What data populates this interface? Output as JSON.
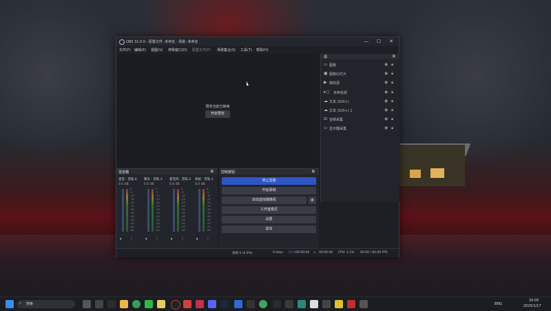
{
  "window": {
    "title": "OBS 31.0.0 - 配置文件: 未命名 - 场景: 未命名",
    "min": "—",
    "max": "☐",
    "close": "✕"
  },
  "menu": [
    "文件(F)",
    "编辑(E)",
    "视图(V)",
    "停靠窗口(D)",
    "配置文件(P)",
    "场景集合(S)",
    "工具(T)",
    "帮助(H)"
  ],
  "preview": {
    "message": "预览当前已禁用",
    "button": "开启预览"
  },
  "sources": {
    "header": "源",
    "items": [
      {
        "label": "图像",
        "icon": "image-icon",
        "glyph": "▭"
      },
      {
        "label": "图像幻灯片",
        "icon": "slideshow-icon",
        "glyph": "▣"
      },
      {
        "label": "媒体源",
        "icon": "play-icon",
        "glyph": "▶"
      },
      {
        "label": "未命名组",
        "icon": "folder-icon",
        "glyph": "▸▢"
      },
      {
        "label": "文本 (GDI+)",
        "icon": "text-icon",
        "glyph": "☁"
      },
      {
        "label": "文本 (GDI+) 2",
        "icon": "text-icon",
        "glyph": "☁"
      },
      {
        "label": "音频采集",
        "icon": "gamepad-icon",
        "glyph": "⊟"
      },
      {
        "label": "显示器采集",
        "icon": "monitor-icon",
        "glyph": "▭"
      }
    ]
  },
  "mixer": {
    "header": "混音器",
    "channels": [
      {
        "name": "混音 - 音轨.6",
        "db": "0.0 dB"
      },
      {
        "name": "聊天 - 音轨.3",
        "db": "0.0 dB"
      },
      {
        "name": "麦克风 - 音轨.2",
        "db": "0.0 dB"
      },
      {
        "name": "系统 - 音轨.1",
        "db": "0.0 dB"
      }
    ],
    "scale": [
      "0",
      "-5",
      "-10",
      "-15",
      "-20",
      "-25",
      "-30",
      "-35",
      "-40",
      "-45",
      "-50",
      "-55",
      "-60"
    ]
  },
  "controls": {
    "header": "控制按钮",
    "buttons": [
      "停止直播",
      "开始录制",
      "启动虚拟摄像机",
      "工作室模式",
      "设置",
      "退出"
    ]
  },
  "status": {
    "dropped": "丢帧 0 (0.0%)",
    "kbps": "0 kbps",
    "stream_time": "00:00:00",
    "rec_time": "00:00:00",
    "cpu": "CPU: 1.1%",
    "fps": "60.00 / 60.00 FPS"
  },
  "taskbar": {
    "search": "搜索",
    "lang": "ENG",
    "time": "20:05",
    "date": "2025/1/17"
  }
}
